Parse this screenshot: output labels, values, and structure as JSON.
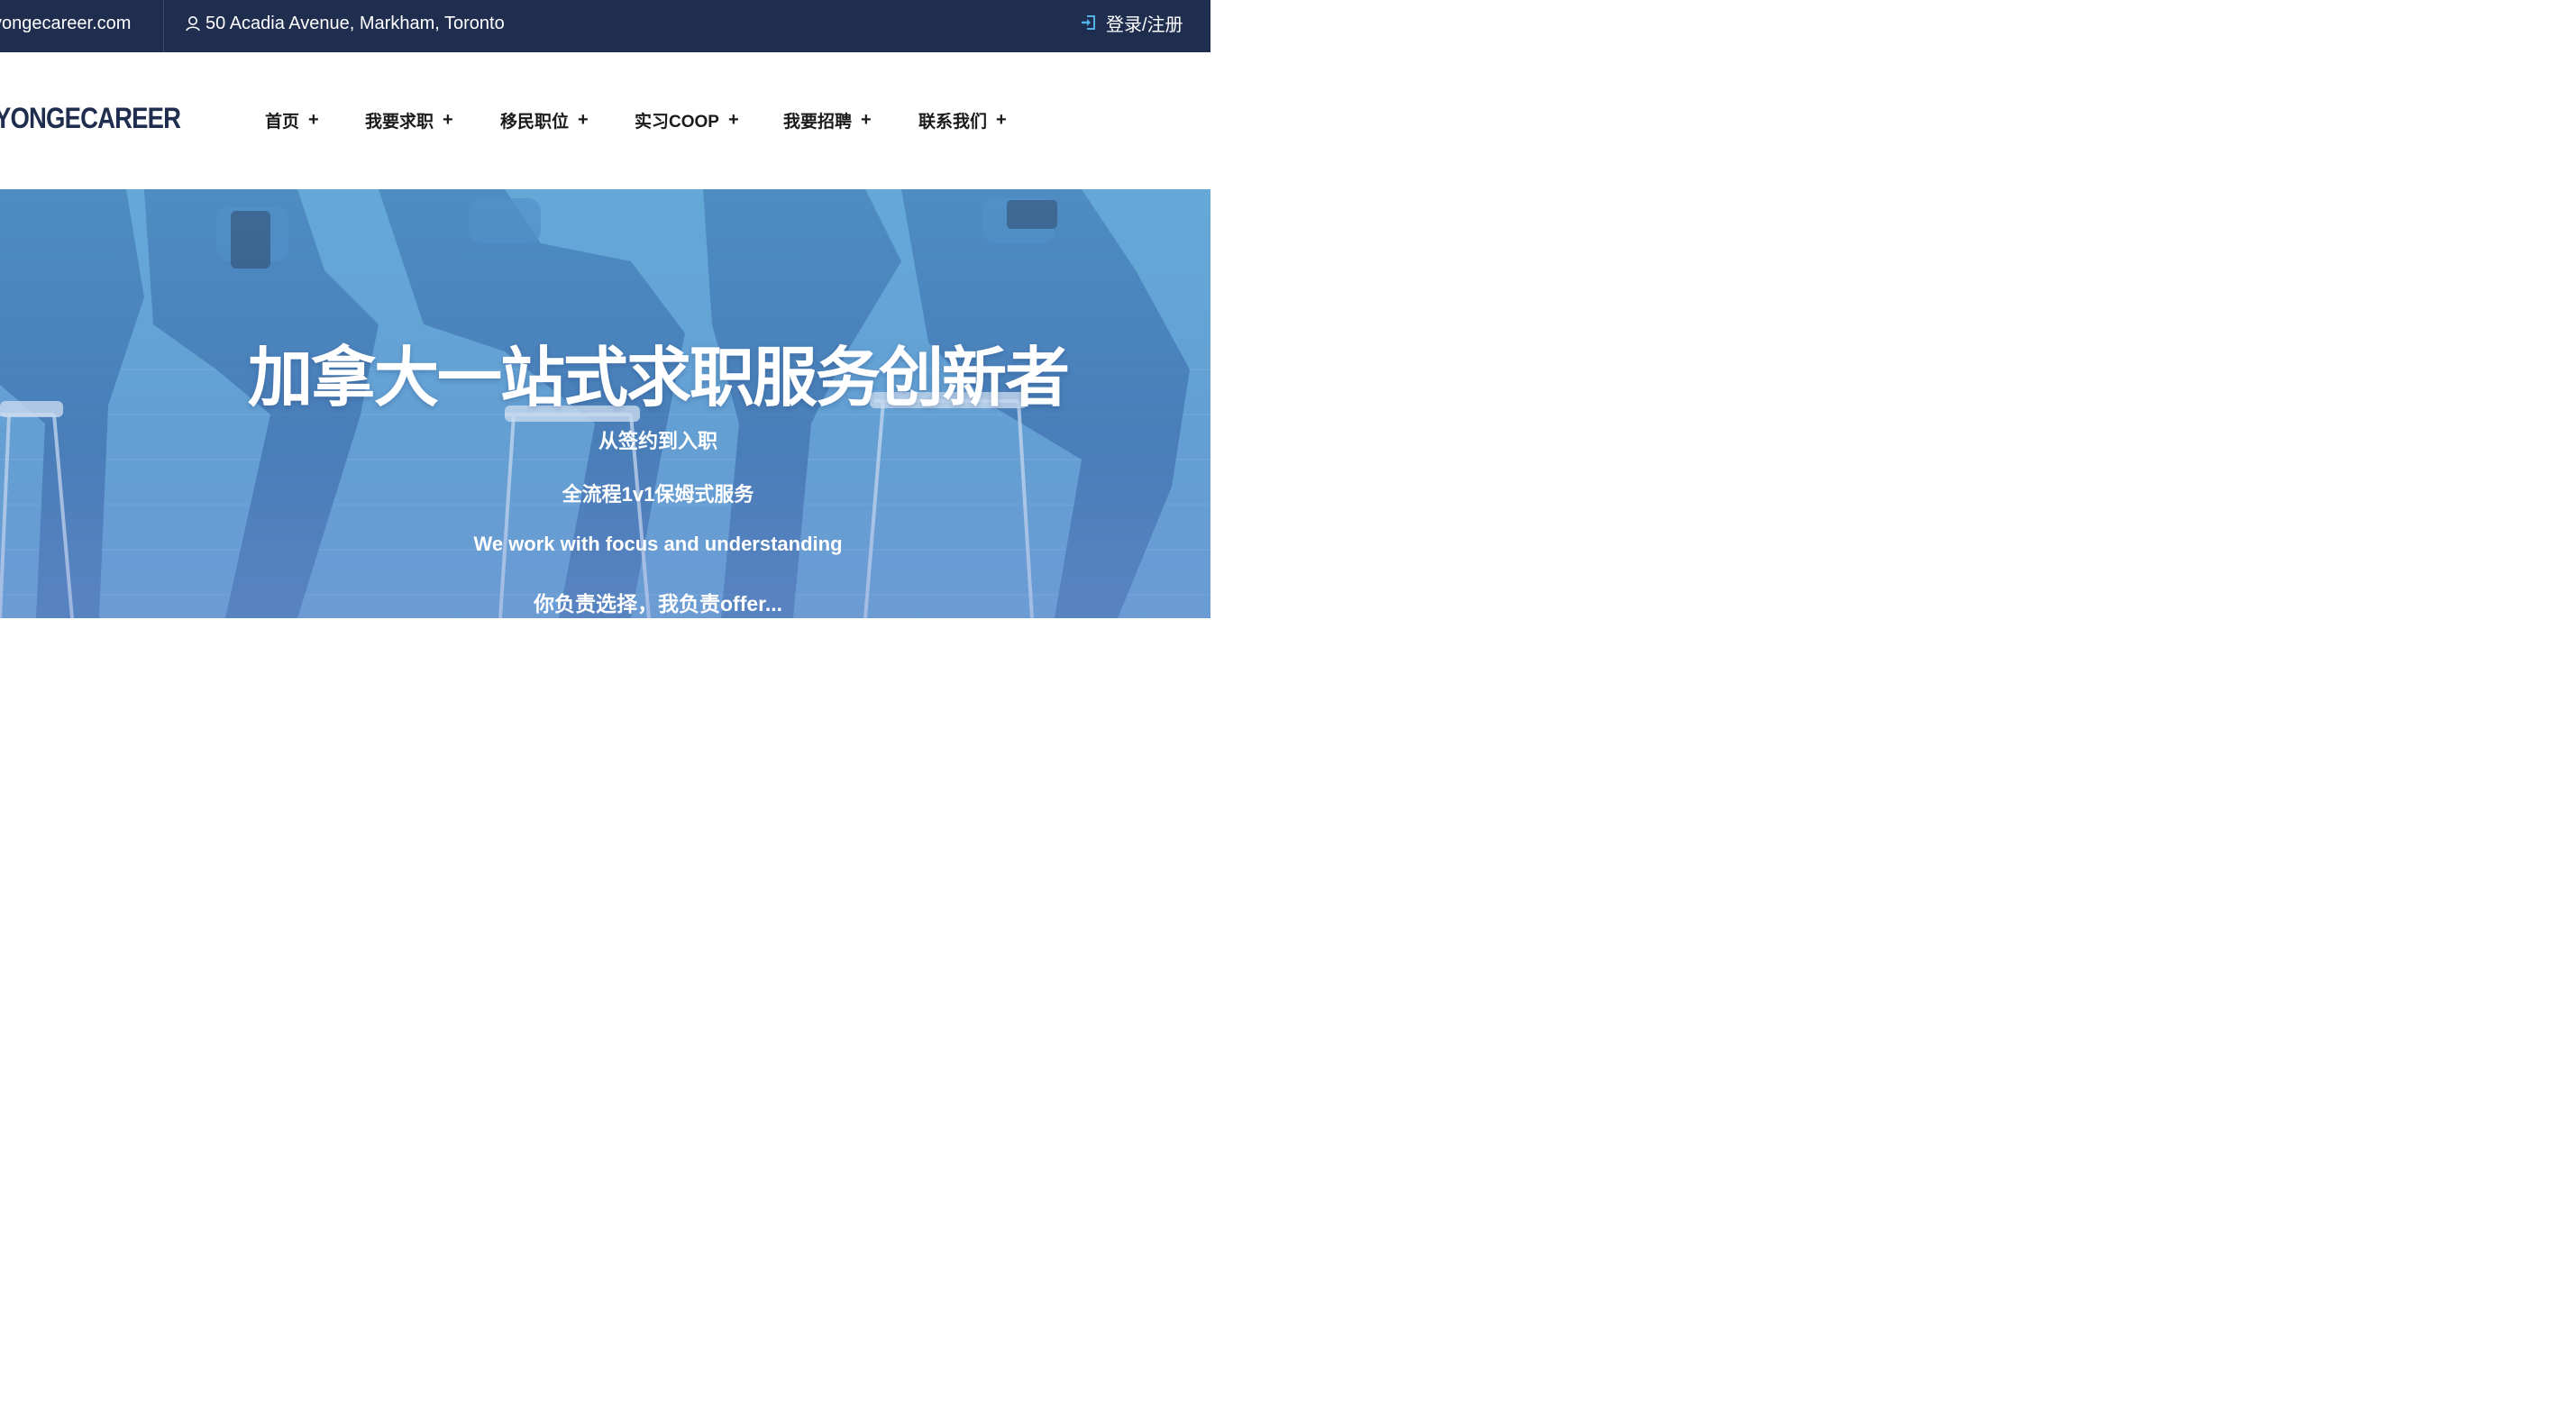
{
  "topbar": {
    "email": "yongecareer.com",
    "address": "50 Acadia Avenue, Markham, Toronto",
    "address_icon": "location-pin-icon",
    "login_label": "登录/注册",
    "login_icon": "sign-in-icon",
    "background_color": "#1f2d4f"
  },
  "brand": {
    "logo_text": "YONGECAREER"
  },
  "nav": {
    "items": [
      {
        "label": "首页",
        "plus": "+"
      },
      {
        "label": "我要求职",
        "plus": "+"
      },
      {
        "label": "移民职位",
        "plus": "+"
      },
      {
        "label": "实习COOP",
        "plus": "+"
      },
      {
        "label": "我要招聘",
        "plus": "+"
      },
      {
        "label": "联系我们",
        "plus": "+"
      }
    ]
  },
  "hero": {
    "title": "加拿大一站式求职服务创新者",
    "line1": "从签约到入职",
    "line2": "全流程1v1保姆式服务",
    "line3": "We work with focus and understanding",
    "line4": "你负责选择，我负责offer...",
    "overlay_color": "#5a97cc"
  }
}
